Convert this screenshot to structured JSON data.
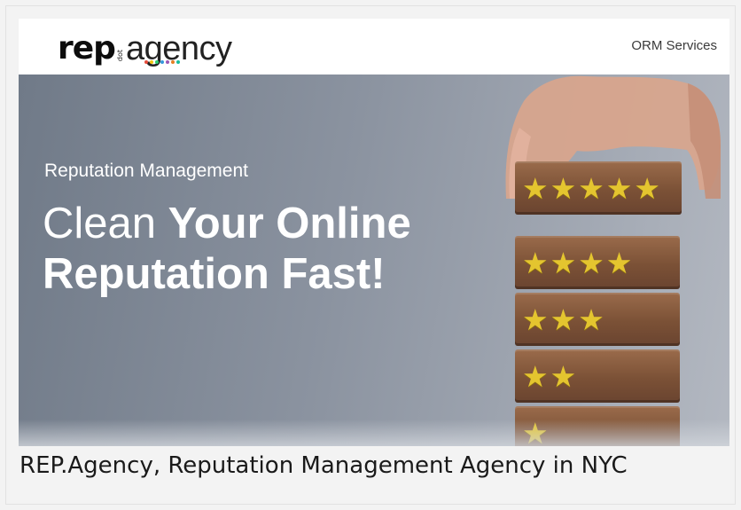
{
  "header": {
    "logo": {
      "rep": "rep",
      "dot": "dot",
      "agency": "agency"
    },
    "nav_link": "ORM Services",
    "logo_dot_colors": [
      "#e74c3c",
      "#f1c40f",
      "#2ecc71",
      "#3498db",
      "#9b59b6",
      "#e67e22",
      "#1abc9c"
    ]
  },
  "hero": {
    "subtitle": "Reputation Management",
    "title_light": "Clean",
    "title_bold_1": "Your Online",
    "title_bold_2": "Reputation Fast!",
    "blocks_star_counts": [
      5,
      4,
      3,
      2,
      1
    ],
    "star_color": "#e4c52f"
  },
  "caption": "REP.Agency, Reputation Management Agency in NYC"
}
